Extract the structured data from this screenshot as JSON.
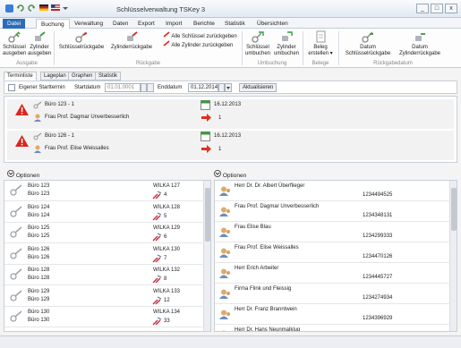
{
  "window": {
    "title": "Schlüsselverwaltung TSKey 3",
    "minimize": "_",
    "maximize": "□",
    "close": "x"
  },
  "menu": {
    "tabs": [
      "Datei",
      "Buchung",
      "Verwaltung",
      "Daten",
      "Export",
      "Import",
      "Berichte",
      "Statistik",
      "Übersichten"
    ],
    "active": "Buchung"
  },
  "ribbon": {
    "ausgabe": {
      "group_label": "Ausgabe",
      "schluessel_line1": "Schlüssel",
      "schluessel_line2": "ausgeben",
      "zylinder_line1": "Zylinder",
      "zylinder_line2": "ausgeben"
    },
    "rueckgabe": {
      "group_label": "Rückgabe",
      "schluesselrueckgabe": "Schlüsselrückgabe",
      "zylinderrueckgabe": "Zylinderrückgabe",
      "alle_schluessel": "Alle Schlüssel zurückgeben",
      "alle_zylinder": "Alle Zylinder zurückgeben"
    },
    "umbuchung": {
      "group_label": "Umbuchung",
      "schluessel_line1": "Schlüssel",
      "schluessel_line2": "umbuchen",
      "zylinder_line1": "Zylinder",
      "zylinder_line2": "umbuchen"
    },
    "belege": {
      "group_label": "Belege",
      "line1": "Beleg",
      "line2": "erstellen ▾"
    },
    "rueckgabedatum": {
      "group_label": "Rückgabedatum",
      "schluessel_line1": "Datum",
      "schluessel_line2": "Schlüsselrückgabe",
      "zylinder_line1": "Datum",
      "zylinder_line2": "Zylinderrückgabe"
    }
  },
  "subtabs": [
    "Terminliste",
    "Lageplan",
    "Graphen",
    "Statistik"
  ],
  "filter": {
    "checkbox_label": "Eigener Starttermin",
    "startdatum_label": "Startdatum",
    "startdatum_value": "01.01.0001",
    "enddatum_label": "Enddatum",
    "enddatum_value": "01.12.2014",
    "refresh_button": "Aktualisieren"
  },
  "appointments": [
    {
      "room": "Büro 123 - 1",
      "person": "Frau Prof. Dagmar Unverbesserlich",
      "date": "16.12.2013",
      "count": "1"
    },
    {
      "room": "Büro 126 - 1",
      "person": "Frau Prof. Elise Weissalles",
      "date": "16.12.2013",
      "count": "1"
    }
  ],
  "left_list": {
    "header": "Optionen",
    "items": [
      {
        "line1": "Büro 123",
        "line2": "Büro 123",
        "code": "WILKA 127",
        "count": "4"
      },
      {
        "line1": "Büro 124",
        "line2": "Büro 124",
        "code": "WILKA 128",
        "count": "5"
      },
      {
        "line1": "Büro 125",
        "line2": "Büro 125",
        "code": "WILKA 129",
        "count": "6"
      },
      {
        "line1": "Büro 126",
        "line2": "Büro 126",
        "code": "WILKA 130",
        "count": "7"
      },
      {
        "line1": "Büro 128",
        "line2": "Büro 128",
        "code": "WILKA 132",
        "count": "8"
      },
      {
        "line1": "Büro 129",
        "line2": "Büro 129",
        "code": "WILKA 133",
        "count": "12"
      },
      {
        "line1": "Büro 130",
        "line2": "Büro 130",
        "code": "WILKA 134",
        "count": "33"
      }
    ]
  },
  "right_list": {
    "header": "Optionen",
    "items": [
      {
        "name": "Herr Dr. Dr. Albert Überflieger",
        "phone": "1234494525"
      },
      {
        "name": "Frau Prof. Dagmar Unverbesserlich",
        "phone": "1234348131"
      },
      {
        "name": "Frau Elise Blau",
        "phone": "1234299333"
      },
      {
        "name": "Frau Prof. Elise Weissalles",
        "phone": "1234470126"
      },
      {
        "name": "Herr Erich Arbeiter",
        "phone": "1234445727"
      },
      {
        "name": "Firma Flink und Fleissig",
        "phone": "1234274934"
      },
      {
        "name": "Herr Dr. Franz Branntwein",
        "phone": "1234396929"
      },
      {
        "name": "Herr Dr. Hans Neunmalklug",
        "phone": ""
      }
    ]
  },
  "colors": {
    "file_tab": "#2b6cb8",
    "alert_red": "#d9261c",
    "arrow_red": "#e0301e",
    "key_green": "#3a9a3a"
  }
}
